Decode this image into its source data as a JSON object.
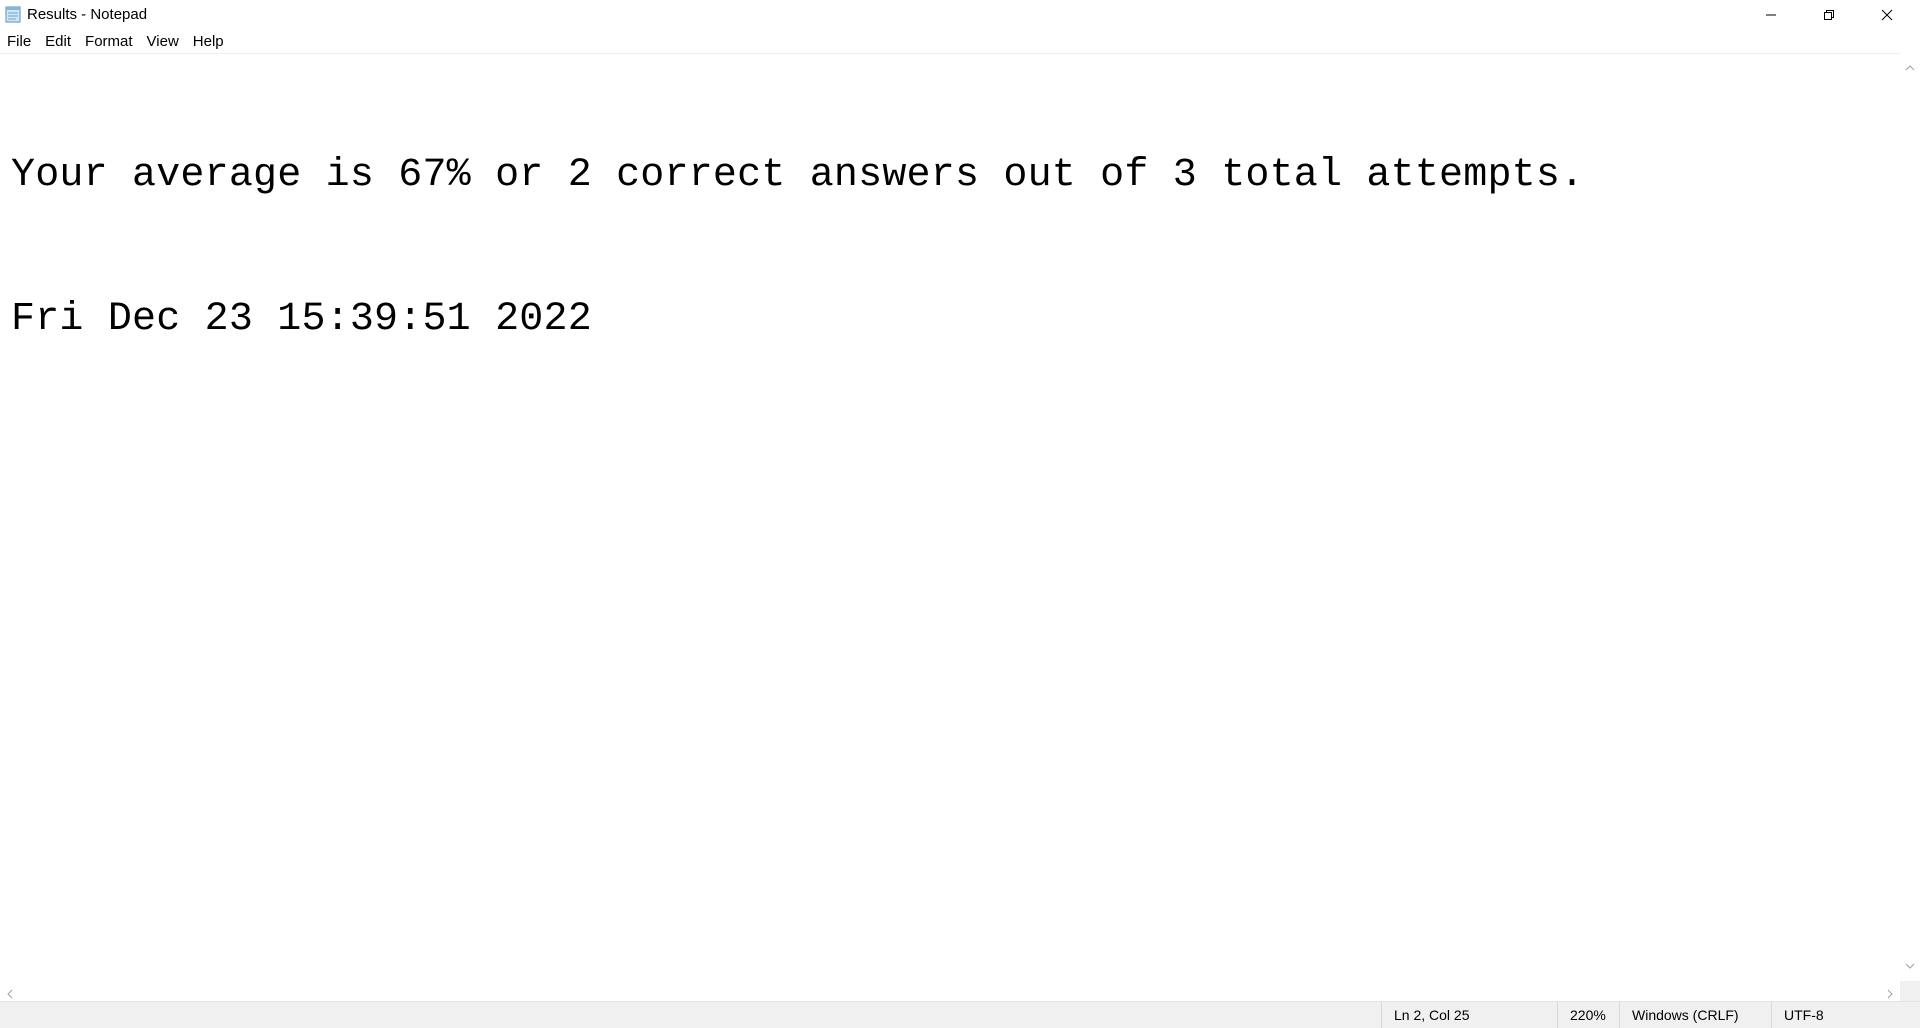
{
  "window": {
    "title": "Results - Notepad"
  },
  "menu": {
    "items": [
      {
        "label": "File"
      },
      {
        "label": "Edit"
      },
      {
        "label": "Format"
      },
      {
        "label": "View"
      },
      {
        "label": "Help"
      }
    ]
  },
  "editor": {
    "lines": [
      "Your average is 67% or 2 correct answers out of 3 total attempts.",
      "Fri Dec 23 15:39:51 2022"
    ]
  },
  "status": {
    "position": "Ln 2, Col 25",
    "zoom": "220%",
    "line_ending": "Windows (CRLF)",
    "encoding": "UTF-8"
  },
  "icons": {
    "app": "notepad-icon",
    "minimize": "minimize-icon",
    "maximize": "restore-icon",
    "close": "close-icon"
  }
}
